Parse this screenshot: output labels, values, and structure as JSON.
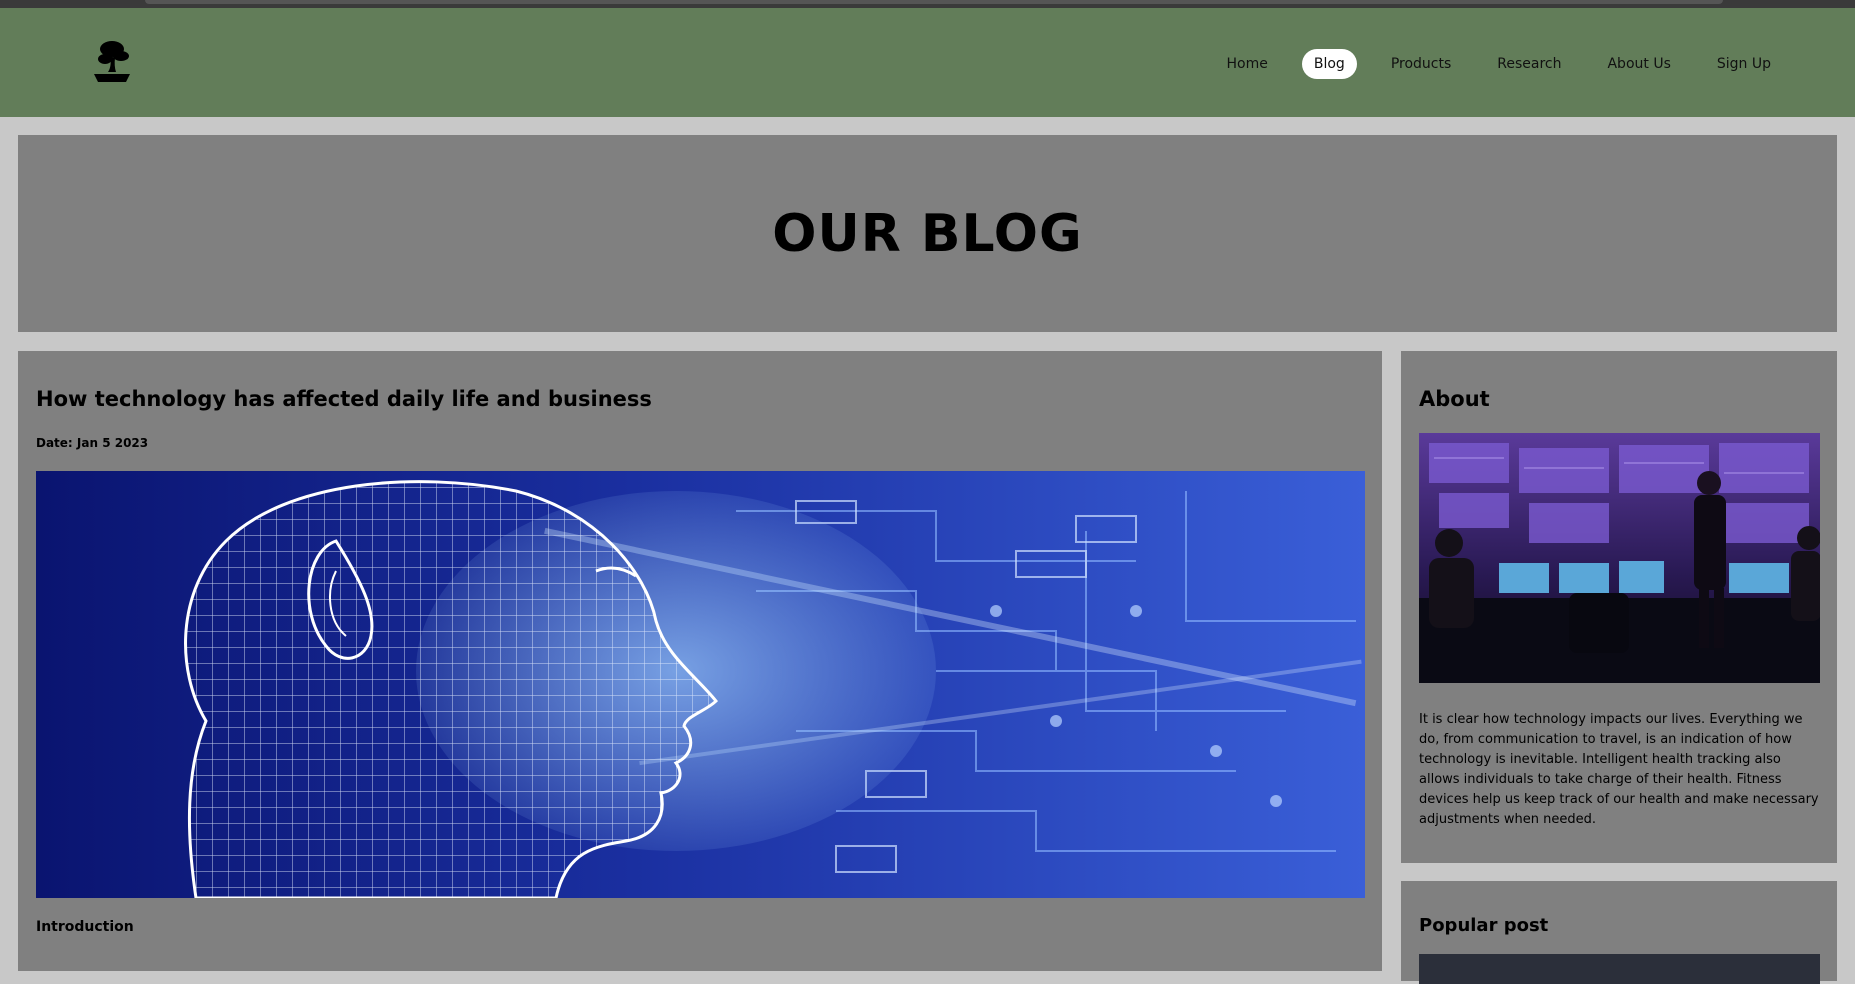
{
  "nav": {
    "items": [
      {
        "label": "Home",
        "active": false
      },
      {
        "label": "Blog",
        "active": true
      },
      {
        "label": "Products",
        "active": false
      },
      {
        "label": "Research",
        "active": false
      },
      {
        "label": "About Us",
        "active": false
      },
      {
        "label": "Sign Up",
        "active": false
      }
    ]
  },
  "hero": {
    "title": "OUR BLOG"
  },
  "post": {
    "title": "How technology has affected daily life and business",
    "date": "Date: Jan 5 2023",
    "image_icon": "ai-face-circuit-image",
    "intro_heading": "Introduction"
  },
  "sidebar": {
    "about_title": "About",
    "about_image_icon": "control-room-image",
    "about_text": "It is clear how technology impacts our lives. Everything we do, from communication to travel, is an indication of how technology is inevitable. Intelligent health tracking also allows individuals to take charge of their health. Fitness devices help us keep track of our health and make necessary adjustments when needed.",
    "popular_title": "Popular post"
  },
  "colors": {
    "navbar": "#627d59",
    "card": "#808080",
    "page_bg": "#c8c8c8"
  }
}
